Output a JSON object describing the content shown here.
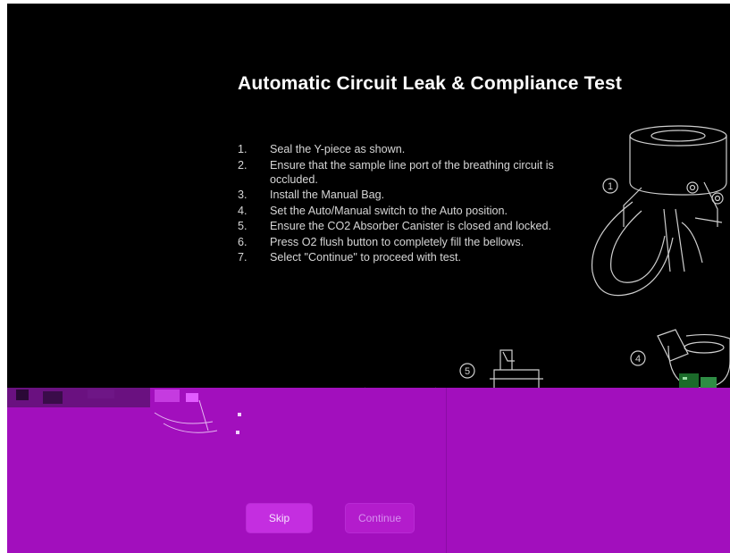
{
  "title": "Automatic Circuit Leak & Compliance Test",
  "steps": [
    {
      "num": "1.",
      "text": "Seal the Y-piece as shown."
    },
    {
      "num": "2.",
      "text": "Ensure that the sample line port of the breathing circuit is occluded."
    },
    {
      "num": "3.",
      "text": "Install the Manual Bag."
    },
    {
      "num": "4.",
      "text": "Set the Auto/Manual switch to the Auto position."
    },
    {
      "num": "5.",
      "text": "Ensure the CO2 Absorber Canister is closed and locked."
    },
    {
      "num": "6.",
      "text": "Press O2 flush button to completely fill the bellows."
    },
    {
      "num": "7.",
      "text": "Select \"Continue\" to proceed with test."
    }
  ],
  "illustration_labels": {
    "one": "1",
    "four": "4",
    "five": "5"
  },
  "buttons": {
    "skip": "Skip",
    "continue": "Continue"
  },
  "colors": {
    "background": "#000000",
    "lower_panel": "#a20fbd",
    "skip_button": "#c42ee0",
    "continue_button": "#b31ccc"
  }
}
